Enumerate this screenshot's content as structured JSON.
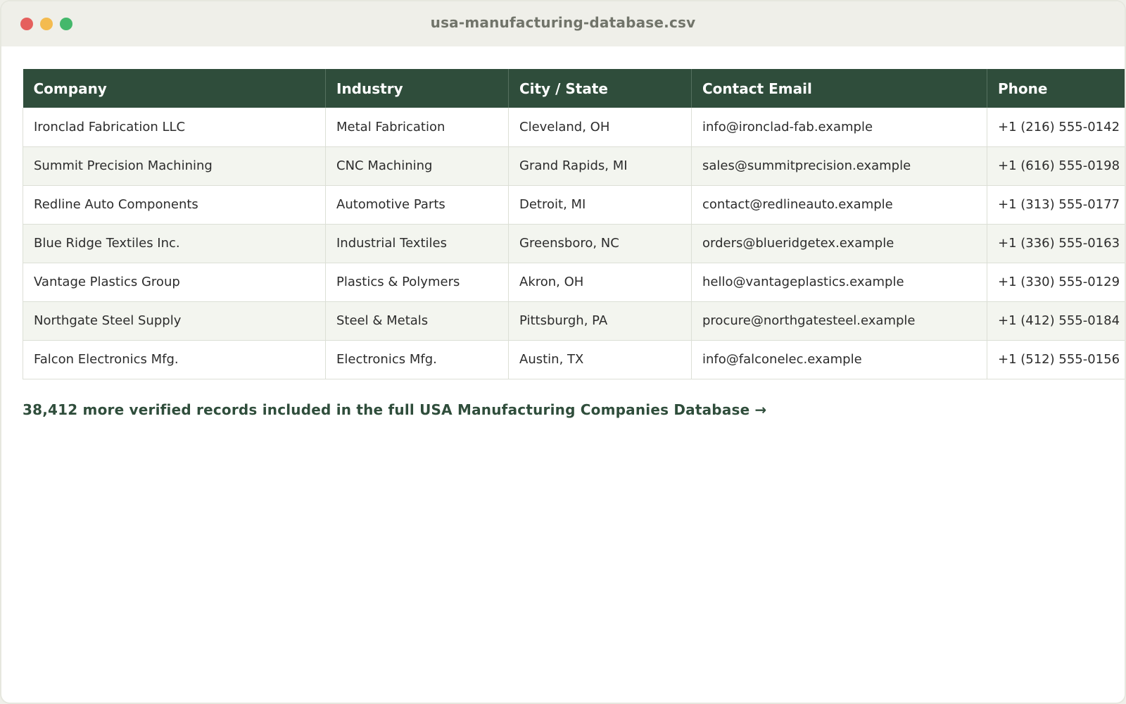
{
  "window": {
    "title": "usa-manufacturing-database.csv"
  },
  "table": {
    "columns": [
      "Company",
      "Industry",
      "City / State",
      "Contact Email",
      "Phone"
    ],
    "rows": [
      [
        "Ironclad Fabrication LLC",
        "Metal Fabrication",
        "Cleveland, OH",
        "info@ironclad-fab.example",
        "+1 (216) 555-0142"
      ],
      [
        "Summit Precision Machining",
        "CNC Machining",
        "Grand Rapids, MI",
        "sales@summitprecision.example",
        "+1 (616) 555-0198"
      ],
      [
        "Redline Auto Components",
        "Automotive Parts",
        "Detroit, MI",
        "contact@redlineauto.example",
        "+1 (313) 555-0177"
      ],
      [
        "Blue Ridge Textiles Inc.",
        "Industrial Textiles",
        "Greensboro, NC",
        "orders@blueridgetex.example",
        "+1 (336) 555-0163"
      ],
      [
        "Vantage Plastics Group",
        "Plastics & Polymers",
        "Akron, OH",
        "hello@vantageplastics.example",
        "+1 (330) 555-0129"
      ],
      [
        "Northgate Steel Supply",
        "Steel & Metals",
        "Pittsburgh, PA",
        "procure@northgatesteel.example",
        "+1 (412) 555-0184"
      ],
      [
        "Falcon Electronics Mfg.",
        "Electronics Mfg.",
        "Austin, TX",
        "info@falconelec.example",
        "+1 (512) 555-0156"
      ]
    ]
  },
  "footer": {
    "cta_text": "38,412 more verified records included in the full USA Manufacturing Companies Database →"
  },
  "colors": {
    "header_bg": "#2f4d3b",
    "row_alt_bg": "#f3f5ef",
    "accent_text": "#2f4d3b",
    "close": "#e5605d",
    "minimize": "#f4bb4f",
    "maximize": "#44b86b"
  }
}
